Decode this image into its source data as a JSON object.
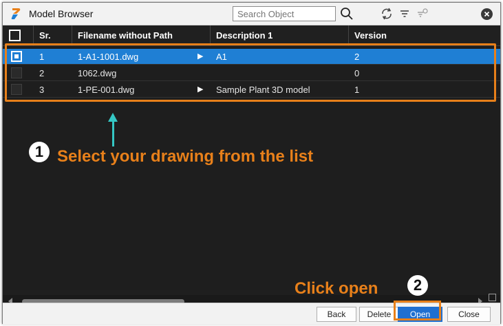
{
  "window": {
    "title": "Model Browser"
  },
  "toolbar": {
    "search_placeholder": "Search Object",
    "icons": [
      "search-icon",
      "refresh-icon",
      "filter-icon",
      "clear-filter-icon",
      "close-icon"
    ]
  },
  "table": {
    "columns": [
      "Sr.",
      "Filename without Path",
      "Description 1",
      "Version"
    ],
    "rows": [
      {
        "sr": "1",
        "filename": "1-A1-1001.dwg",
        "description": "A1",
        "version": "2",
        "selected": true,
        "has_children": true
      },
      {
        "sr": "2",
        "filename": "1062.dwg",
        "description": "",
        "version": "0",
        "selected": false,
        "has_children": false
      },
      {
        "sr": "3",
        "filename": "1-PE-001.dwg",
        "description": "Sample Plant 3D model",
        "version": "1",
        "selected": false,
        "has_children": true
      }
    ]
  },
  "annotations": {
    "step1_number": "1",
    "step1_text": "Select your drawing from the list",
    "step2_number": "2",
    "step2_text": "Click open"
  },
  "footer": {
    "back_label": "Back",
    "delete_label": "Delete",
    "open_label": "Open",
    "close_label": "Close"
  },
  "colors": {
    "selection": "#1f7fd4",
    "annotation": "#e8801a",
    "arrow": "#35c7c4",
    "background": "#1e1e1e"
  }
}
